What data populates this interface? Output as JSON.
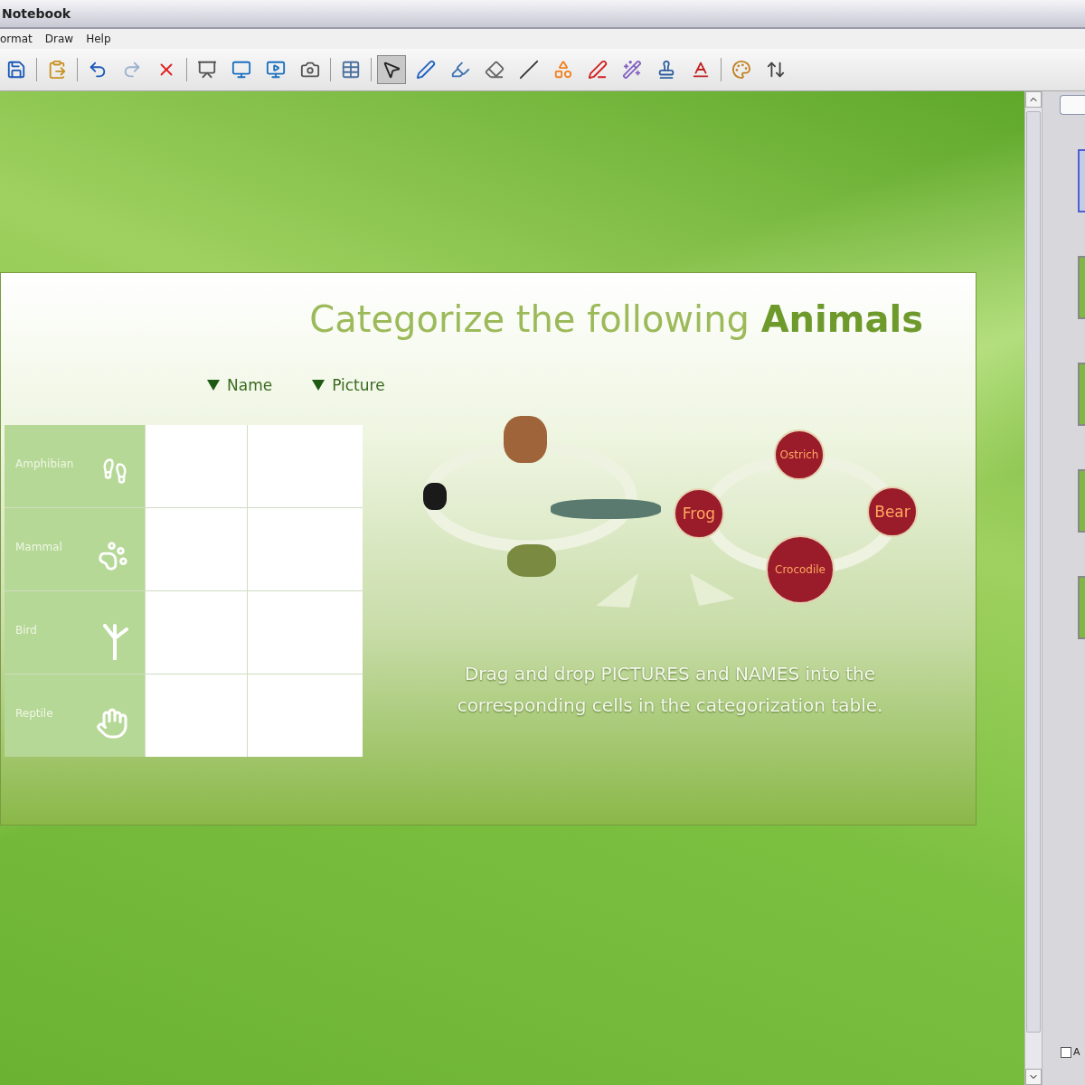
{
  "window": {
    "title": "Notebook"
  },
  "menu": [
    "ormat",
    "Draw",
    "Help"
  ],
  "slide": {
    "title": "Categorize the following **Animals**",
    "headers": [
      "Name",
      "Picture"
    ],
    "rows": [
      {
        "label": "Amphibian",
        "kind": "amphibian"
      },
      {
        "label": "Mammal",
        "kind": "mammal"
      },
      {
        "label": "Bird",
        "kind": "bird"
      },
      {
        "label": "Reptile",
        "kind": "reptile"
      }
    ],
    "name_tokens": [
      "Ostrich",
      "Frog",
      "Bear",
      "Crocodile"
    ],
    "instruction": "Drag and drop PICTURES and NAMES into the corresponding cells in the categorization table."
  },
  "side_panel": {
    "pages": [
      {
        "selected": true
      },
      {
        "selected": false
      },
      {
        "selected": false
      },
      {
        "selected": false
      },
      {
        "selected": false
      }
    ],
    "checkbox": {
      "label": "A",
      "checked": false
    }
  }
}
